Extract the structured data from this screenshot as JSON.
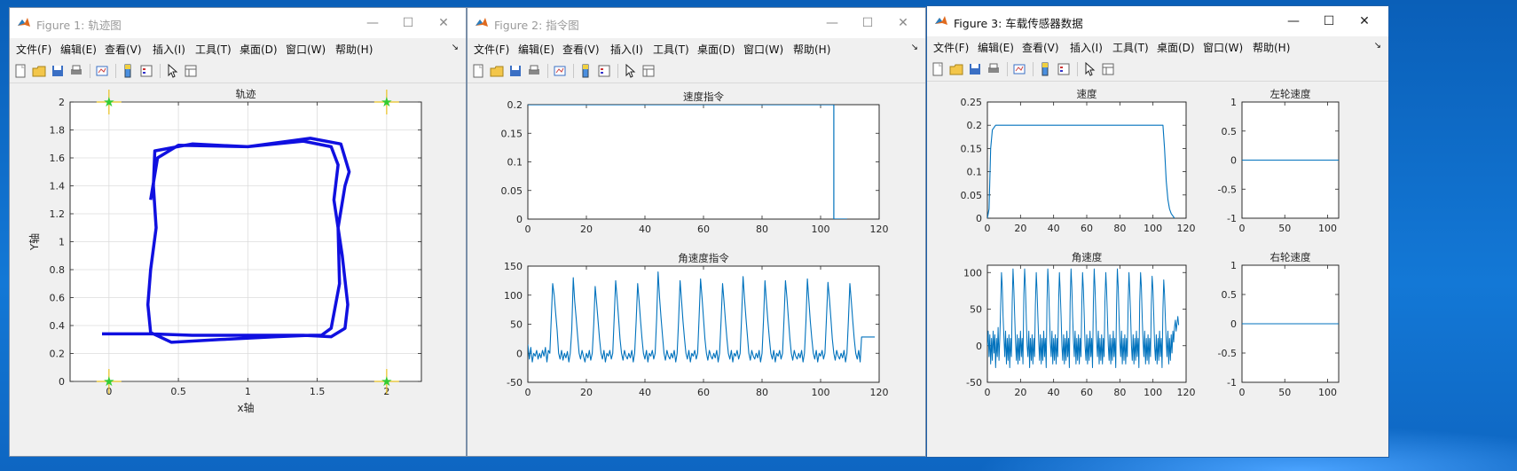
{
  "windows": [
    {
      "title": "Figure 1: 轨迹图",
      "menus": [
        "文件(F)",
        "编辑(E)",
        "查看(V)",
        "插入(I)",
        "工具(T)",
        "桌面(D)",
        "窗口(W)",
        "帮助(H)"
      ],
      "plots": [
        {
          "title": "轨迹",
          "xlabel": "x轴",
          "ylabel": "Y轴",
          "xticks": [
            "0",
            "0.5",
            "1",
            "1.5",
            "2"
          ],
          "yticks": [
            "0",
            "0.2",
            "0.4",
            "0.6",
            "0.8",
            "1",
            "1.2",
            "1.4",
            "1.6",
            "1.8",
            "2"
          ]
        }
      ]
    },
    {
      "title": "Figure 2: 指令图",
      "menus": [
        "文件(F)",
        "编辑(E)",
        "查看(V)",
        "插入(I)",
        "工具(T)",
        "桌面(D)",
        "窗口(W)",
        "帮助(H)"
      ],
      "plots": [
        {
          "title": "速度指令",
          "xticks": [
            "0",
            "20",
            "40",
            "60",
            "80",
            "100",
            "120"
          ],
          "yticks": [
            "0",
            "0.05",
            "0.1",
            "0.15",
            "0.2"
          ]
        },
        {
          "title": "角速度指令",
          "xticks": [
            "0",
            "20",
            "40",
            "60",
            "80",
            "100",
            "120"
          ],
          "yticks": [
            "-50",
            "0",
            "50",
            "100",
            "150"
          ]
        }
      ]
    },
    {
      "title": "Figure 3: 车载传感器数据",
      "menus": [
        "文件(F)",
        "编辑(E)",
        "查看(V)",
        "插入(I)",
        "工具(T)",
        "桌面(D)",
        "窗口(W)",
        "帮助(H)"
      ],
      "plots": [
        {
          "title": "速度",
          "xticks": [
            "0",
            "20",
            "40",
            "60",
            "80",
            "100",
            "120"
          ],
          "yticks": [
            "0",
            "0.05",
            "0.1",
            "0.15",
            "0.2",
            "0.25"
          ]
        },
        {
          "title": "左轮速度",
          "xticks": [
            "0",
            "50",
            "100"
          ],
          "yticks": [
            "-1",
            "-0.5",
            "0",
            "0.5",
            "1"
          ]
        },
        {
          "title": "角速度",
          "xticks": [
            "0",
            "20",
            "40",
            "60",
            "80",
            "100",
            "120"
          ],
          "yticks": [
            "-50",
            "0",
            "50",
            "100"
          ]
        },
        {
          "title": "右轮速度",
          "xticks": [
            "0",
            "50",
            "100"
          ],
          "yticks": [
            "-1",
            "-0.5",
            "0",
            "0.5",
            "1"
          ]
        }
      ]
    }
  ],
  "colors": {
    "line": "#0072bd",
    "trajectory": "#1010e0",
    "marker": "#33cc33",
    "active_border": "#1f5fa8"
  },
  "chart_data": [
    {
      "type": "line",
      "title": "轨迹",
      "xlabel": "x轴",
      "ylabel": "Y轴",
      "xlim": [
        -0.28,
        2.25
      ],
      "ylim": [
        0,
        2
      ],
      "grid": true,
      "markers": [
        [
          0,
          0
        ],
        [
          2,
          0
        ],
        [
          0,
          2
        ],
        [
          2,
          2
        ]
      ],
      "series": [
        {
          "x": [
            -0.05,
            0.3,
            0.6,
            1.0,
            1.4,
            1.6,
            1.7,
            1.72,
            1.68,
            1.62,
            1.65,
            1.6,
            1.4,
            1.0,
            0.6,
            0.33,
            0.32,
            0.34,
            0.3,
            0.28,
            0.3,
            0.45,
            0.8,
            1.2,
            1.45,
            1.53,
            1.6,
            1.66,
            1.65,
            1.7,
            1.73,
            1.67,
            1.45,
            1.0,
            0.5,
            0.35,
            0.3
          ],
          "y": [
            0.34,
            0.34,
            0.33,
            0.33,
            0.33,
            0.32,
            0.38,
            0.55,
            0.9,
            1.3,
            1.55,
            1.68,
            1.72,
            1.68,
            1.7,
            1.65,
            1.4,
            1.1,
            0.8,
            0.55,
            0.35,
            0.28,
            0.3,
            0.32,
            0.33,
            0.33,
            0.38,
            0.7,
            1.1,
            1.4,
            1.5,
            1.7,
            1.74,
            1.68,
            1.69,
            1.6,
            1.3
          ]
        }
      ]
    },
    {
      "type": "line",
      "title": "速度指令",
      "xlim": [
        0,
        120
      ],
      "ylim": [
        0,
        0.2
      ],
      "grid": false,
      "series": [
        {
          "x": [
            0,
            104.5,
            104.5,
            109
          ],
          "y": [
            0.2,
            0.2,
            0,
            0
          ]
        }
      ]
    },
    {
      "type": "line",
      "title": "角速度指令",
      "xlim": [
        0,
        120
      ],
      "ylim": [
        -50,
        150
      ],
      "grid": false,
      "series": [
        {
          "x_start": 0,
          "x_step": 0.5,
          "y": [
            15,
            -10,
            10,
            -15,
            0,
            -5,
            5,
            -10,
            0,
            -8,
            5,
            -5,
            10,
            -15,
            5,
            0,
            60,
            120,
            100,
            70,
            40,
            0,
            -10,
            5,
            -12,
            0,
            -8,
            3,
            -15,
            0,
            40,
            130,
            90,
            60,
            30,
            0,
            -10,
            5,
            -5,
            -15,
            0,
            -8,
            5,
            -12,
            0,
            50,
            115,
            85,
            55,
            25,
            0,
            -10,
            5,
            -15,
            0,
            -5,
            5,
            -10,
            0,
            60,
            125,
            95,
            60,
            25,
            0,
            -12,
            5,
            -5,
            -10,
            0,
            -8,
            5,
            -15,
            0,
            55,
            120,
            90,
            55,
            25,
            0,
            -10,
            5,
            -15,
            0,
            -5,
            5,
            -10,
            0,
            60,
            140,
            95,
            60,
            30,
            0,
            -12,
            5,
            -5,
            -10,
            0,
            -8,
            5,
            -15,
            0,
            55,
            125,
            90,
            55,
            25,
            0,
            -10,
            5,
            -15,
            0,
            -5,
            5,
            -10,
            0,
            60,
            128,
            95,
            60,
            25,
            0,
            -12,
            5,
            -5,
            -10,
            0,
            -8,
            5,
            -15,
            0,
            55,
            120,
            90,
            55,
            25,
            0,
            -10,
            5,
            -15,
            0,
            -5,
            5,
            -10,
            0,
            60,
            132,
            95,
            60,
            30,
            0,
            -12,
            5,
            -5,
            -10,
            0,
            -8,
            5,
            -15,
            0,
            55,
            125,
            90,
            55,
            25,
            0,
            -10,
            5,
            -15,
            0,
            -5,
            5,
            -10,
            0,
            60,
            125,
            95,
            60,
            25,
            0,
            -12,
            5,
            -5,
            -10,
            0,
            -8,
            5,
            -15,
            0,
            55,
            128,
            90,
            55,
            25,
            0,
            -10,
            5,
            -15,
            0,
            -5,
            5,
            -10,
            0,
            60,
            122,
            95,
            60,
            25,
            0,
            -12,
            5,
            -5,
            -10,
            0,
            -8,
            5,
            -15,
            0,
            55,
            120,
            90,
            55,
            25,
            0,
            -10,
            5,
            -15,
            28,
            28,
            28,
            28,
            28,
            28,
            28,
            28,
            28,
            28
          ]
        }
      ]
    },
    {
      "type": "line",
      "title": "速度",
      "xlim": [
        0,
        120
      ],
      "ylim": [
        0,
        0.25
      ],
      "grid": false,
      "series": [
        {
          "x": [
            0,
            1,
            2,
            3,
            5,
            10,
            20,
            30,
            40,
            50,
            60,
            70,
            80,
            90,
            100,
            105,
            106,
            107,
            108,
            109,
            110,
            111,
            112,
            113
          ],
          "y": [
            0,
            0.02,
            0.15,
            0.19,
            0.2,
            0.2,
            0.2,
            0.2,
            0.2,
            0.2,
            0.2,
            0.2,
            0.2,
            0.2,
            0.2,
            0.2,
            0.2,
            0.15,
            0.08,
            0.04,
            0.02,
            0.01,
            0.005,
            0
          ]
        }
      ]
    },
    {
      "type": "line",
      "title": "左轮速度",
      "xlim": [
        0,
        113
      ],
      "ylim": [
        -1,
        1
      ],
      "grid": false,
      "series": [
        {
          "x": [
            0,
            113
          ],
          "y": [
            0,
            0
          ]
        }
      ]
    },
    {
      "type": "line",
      "title": "角速度",
      "xlim": [
        0,
        120
      ],
      "ylim": [
        -50,
        110
      ],
      "grid": false,
      "series": [
        {
          "x_start": 0,
          "x_step": 0.5,
          "y": [
            0,
            20,
            -15,
            15,
            -25,
            10,
            -20,
            20,
            -10,
            15,
            -30,
            10,
            -15,
            25,
            -20,
            10,
            50,
            100,
            80,
            40,
            10,
            -15,
            20,
            -25,
            10,
            -20,
            15,
            -30,
            10,
            -15,
            60,
            105,
            75,
            40,
            5,
            -20,
            15,
            -25,
            10,
            -20,
            20,
            -15,
            10,
            -25,
            70,
            105,
            80,
            35,
            0,
            -15,
            20,
            -30,
            10,
            -20,
            15,
            -25,
            10,
            -15,
            55,
            100,
            75,
            40,
            5,
            -20,
            15,
            -25,
            10,
            -20,
            20,
            -15,
            10,
            -30,
            60,
            105,
            80,
            40,
            5,
            -15,
            20,
            -25,
            10,
            -20,
            15,
            -25,
            10,
            -15,
            60,
            100,
            75,
            40,
            0,
            -20,
            15,
            -25,
            10,
            -20,
            20,
            -15,
            10,
            -30,
            60,
            105,
            80,
            40,
            5,
            -15,
            20,
            -25,
            10,
            -20,
            15,
            -25,
            10,
            -15,
            55,
            100,
            75,
            40,
            0,
            -20,
            15,
            -25,
            10,
            -20,
            20,
            -15,
            10,
            -30,
            60,
            105,
            80,
            40,
            5,
            -15,
            20,
            -25,
            10,
            -20,
            15,
            -25,
            10,
            -15,
            60,
            100,
            75,
            40,
            0,
            -20,
            15,
            -25,
            10,
            -20,
            20,
            -15,
            10,
            -30,
            55,
            105,
            80,
            40,
            5,
            -15,
            20,
            -25,
            10,
            -20,
            15,
            -25,
            10,
            -15,
            60,
            100,
            75,
            40,
            0,
            -20,
            15,
            -25,
            10,
            -20,
            20,
            -15,
            10,
            -30,
            60,
            100,
            80,
            40,
            5,
            -15,
            20,
            -25,
            10,
            -20,
            15,
            -25,
            10,
            -15,
            55,
            95,
            75,
            40,
            0,
            -20,
            15,
            -25,
            10,
            -20,
            20,
            -15,
            10,
            -30,
            50,
            90,
            70,
            35,
            5,
            -15,
            20,
            -25,
            10,
            -20,
            15,
            -10,
            20,
            5,
            25,
            35,
            20,
            30,
            40,
            28
          ]
        }
      ]
    },
    {
      "type": "line",
      "title": "右轮速度",
      "xlim": [
        0,
        113
      ],
      "ylim": [
        -1,
        1
      ],
      "grid": false,
      "series": [
        {
          "x": [
            0,
            113
          ],
          "y": [
            0,
            0
          ]
        }
      ]
    }
  ]
}
